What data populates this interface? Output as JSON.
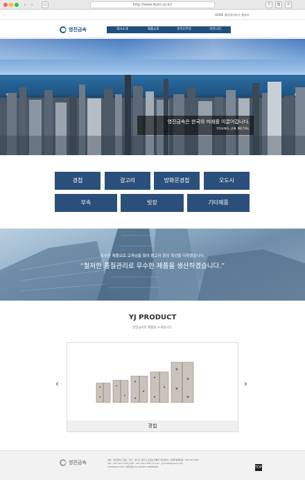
{
  "browser": {
    "url": "http://www.4yjm.co.kr/"
  },
  "util_nav": {
    "items": [
      "HOME",
      "즐겨찾기추가",
      "관리자"
    ]
  },
  "header": {
    "logo_text": "영진금속",
    "menu": [
      "회사소개",
      "제품소개",
      "온라인주문",
      "커뮤니티"
    ]
  },
  "hero": {
    "caption_ko": "영진금속은 한국의 미래를 이끌어갑니다.",
    "caption_en": "YOUNG-JIN METAL"
  },
  "categories": {
    "row1": [
      "경첩",
      "걸고리",
      "방화문경첩",
      "오도시"
    ],
    "row2": [
      "부속",
      "빗장",
      "기타제품"
    ]
  },
  "banner": {
    "line1": "우수한 제품으로 고객님을 찾아 뵙고자 항상 최선을 다하겠습니다.",
    "line2": "“철저한 품질관리로 우수한 제품을 생산하겠습니다.”"
  },
  "product": {
    "title": "YJ PRODUCT",
    "subtitle": "영진금속의 제품을 소개합니다.",
    "card_caption": "경첩"
  },
  "footer": {
    "logo_text": "영진금속",
    "line1": "상호 : 영진금속 | 대표 : 주소 : 경기도 광주시 오포읍 양벌리 영진금속 | 사업자등록번호 : 606-95-7995",
    "line2": "TEL : 031-767-7725 | FAX : 031-767-7726 | E-mail : yjm7995@naver.com",
    "line3": "COPYRIGHT 2017 영진금속 ALL RIGHTS RESERVED.",
    "top_label": "TOP"
  }
}
